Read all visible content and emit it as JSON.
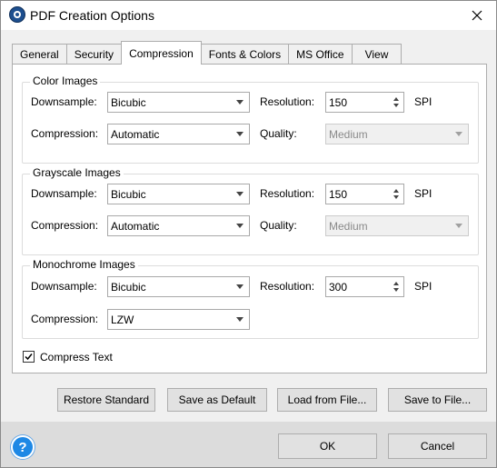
{
  "window": {
    "title": "PDF Creation Options"
  },
  "tabs": [
    {
      "label": "General"
    },
    {
      "label": "Security"
    },
    {
      "label": "Compression",
      "active": true
    },
    {
      "label": "Fonts & Colors"
    },
    {
      "label": "MS Office"
    },
    {
      "label": "View"
    }
  ],
  "labels": {
    "downsample": "Downsample:",
    "compression": "Compression:",
    "resolution": "Resolution:",
    "quality": "Quality:",
    "unit": "SPI"
  },
  "color_images": {
    "title": "Color Images",
    "downsample": "Bicubic",
    "compression": "Automatic",
    "resolution": "150",
    "quality": "Medium"
  },
  "grayscale_images": {
    "title": "Grayscale Images",
    "downsample": "Bicubic",
    "compression": "Automatic",
    "resolution": "150",
    "quality": "Medium"
  },
  "monochrome_images": {
    "title": "Monochrome Images",
    "downsample": "Bicubic",
    "compression": "LZW",
    "resolution": "300"
  },
  "compress_text": {
    "label": "Compress Text",
    "checked": true
  },
  "buttons": {
    "restore_standard": "Restore Standard",
    "save_as_default": "Save as Default",
    "load_from_file": "Load from File...",
    "save_to_file": "Save to File...",
    "ok": "OK",
    "cancel": "Cancel",
    "help": "?"
  },
  "colors": {
    "help_blue": "#1e88e5",
    "footer_bg": "#dcdcdc",
    "dialog_bg": "#f0f0f0"
  },
  "icons": {
    "app": "pdf-app-icon",
    "close": "close-icon",
    "help": "help-icon",
    "check": "checkmark-icon"
  }
}
